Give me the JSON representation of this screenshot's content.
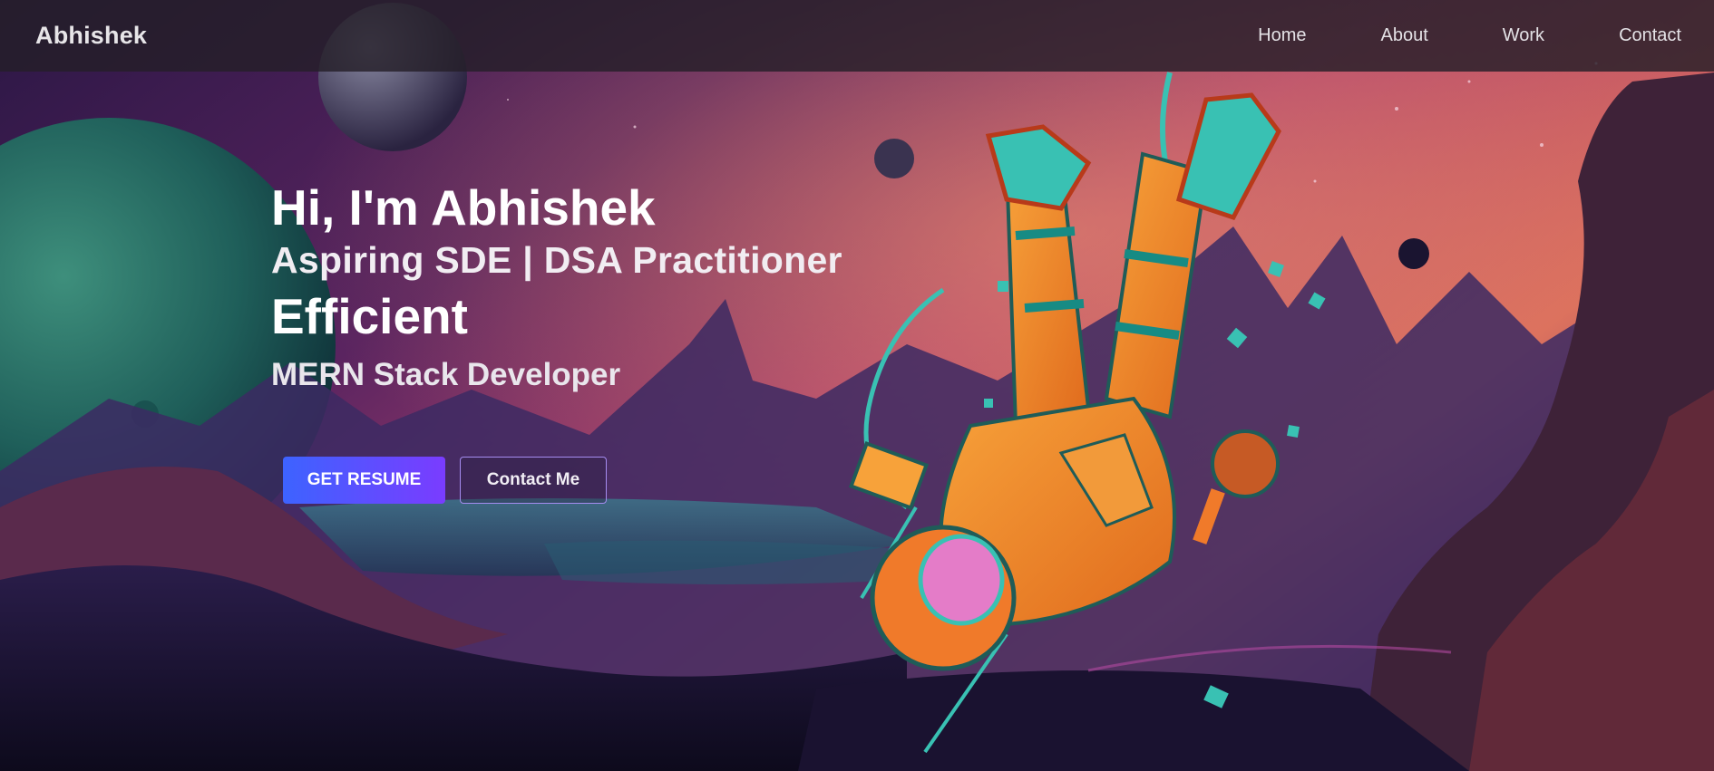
{
  "navbar": {
    "brand": "Abhishek",
    "links": [
      {
        "label": "Home"
      },
      {
        "label": "About"
      },
      {
        "label": "Work"
      },
      {
        "label": "Contact"
      }
    ]
  },
  "hero": {
    "greeting": "Hi, I'm Abhishek",
    "role": "Aspiring SDE | DSA Practitioner",
    "typed_word": "Efficient",
    "stack": "MERN Stack Developer",
    "primary_button": "GET RESUME",
    "secondary_button": "Contact Me"
  },
  "background": {
    "scene": "space-landscape-illustration",
    "subject": "astronaut-illustration"
  },
  "colors": {
    "accent_start": "#3d63ff",
    "accent_end": "#7a3cff",
    "outline": "#a58cf0",
    "navbar_bg": "#241e28"
  }
}
